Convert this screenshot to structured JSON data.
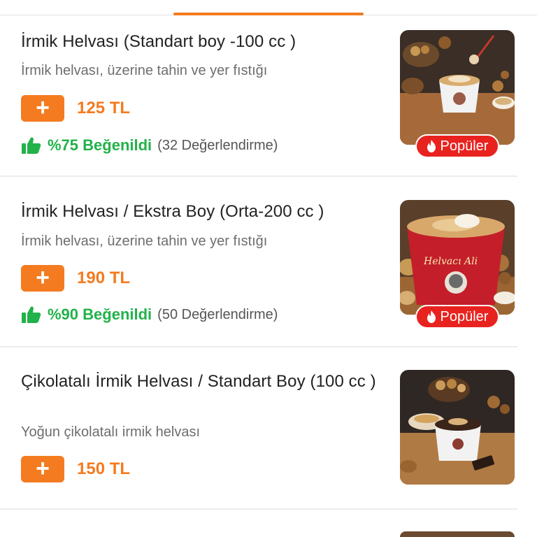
{
  "tabbar": {
    "active_index": 1
  },
  "items": [
    {
      "title": "İrmik Helvası (Standart boy -100 cc )",
      "description": "İrmik helvası, üzerine tahin ve yer fıstığı",
      "add_label": "+",
      "price": "125 TL",
      "liked": "%75 Beğenildi",
      "rating_count": "(32 Değerlendirme)",
      "badge": "Popüler"
    },
    {
      "title": "İrmik Helvası / Ekstra Boy (Orta-200 cc )",
      "description": "İrmik helvası, üzerine tahin ve yer fıstığı",
      "add_label": "+",
      "price": "190 TL",
      "liked": "%90 Beğenildi",
      "rating_count": "(50 Değerlendirme)",
      "badge": "Popüler"
    },
    {
      "title": "Çikolatalı İrmik Helvası / Standart Boy (100 cc )",
      "description": "Yoğun çikolatalı irmik helvası",
      "add_label": "+",
      "price": "150 TL"
    }
  ],
  "colors": {
    "accent": "#f47b20",
    "liked": "#21b24a",
    "badge": "#e8231f"
  },
  "icons": {
    "add": "plus-icon",
    "liked": "thumbs-up-icon",
    "badge": "flame-icon"
  }
}
